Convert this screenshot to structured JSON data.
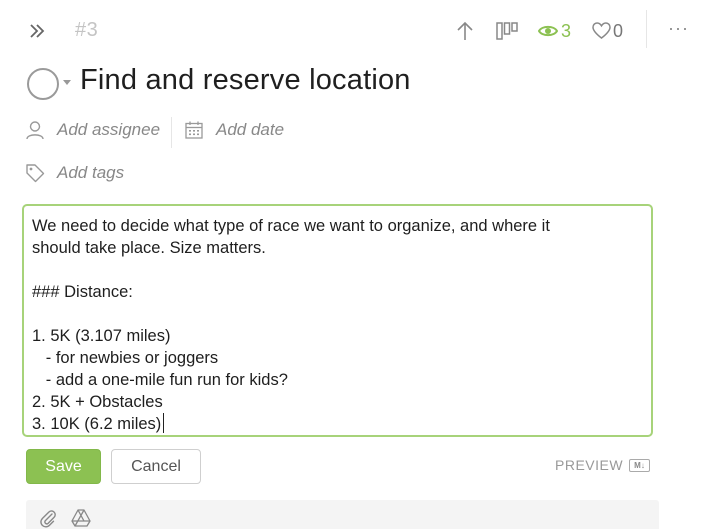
{
  "header": {
    "task_number": "#3",
    "followers_count": "3",
    "likes_count": "0",
    "more_label": "···"
  },
  "task": {
    "title": "Find and reserve location"
  },
  "meta": {
    "assignee_placeholder": "Add assignee",
    "date_placeholder": "Add date",
    "tags_placeholder": "Add tags"
  },
  "editor": {
    "content": "We need to decide what type of race we want to organize, and where it\nshould take place. Size matters.\n\n### Distance:\n\n1. 5K (3.107 miles)\n   - for newbies or joggers\n   - add a one-mile fun run for kids?\n2. 5K + Obstacles\n3. 10K (6.2 miles)"
  },
  "actions": {
    "save_label": "Save",
    "cancel_label": "Cancel",
    "preview_label": "PREVIEW",
    "markdown_badge": "M↓"
  },
  "icons": {
    "collapse": "double-chevron-right-icon",
    "move_up": "arrow-up-icon",
    "board": "board-columns-icon",
    "followers": "eye-icon",
    "likes": "heart-icon",
    "assignee": "user-icon",
    "date": "calendar-icon",
    "tags": "tag-icon",
    "attach": "paperclip-icon",
    "drive": "google-drive-icon"
  },
  "colors": {
    "accent": "#8cc152",
    "editor_border": "#a7d37a",
    "muted_text": "#888888"
  }
}
